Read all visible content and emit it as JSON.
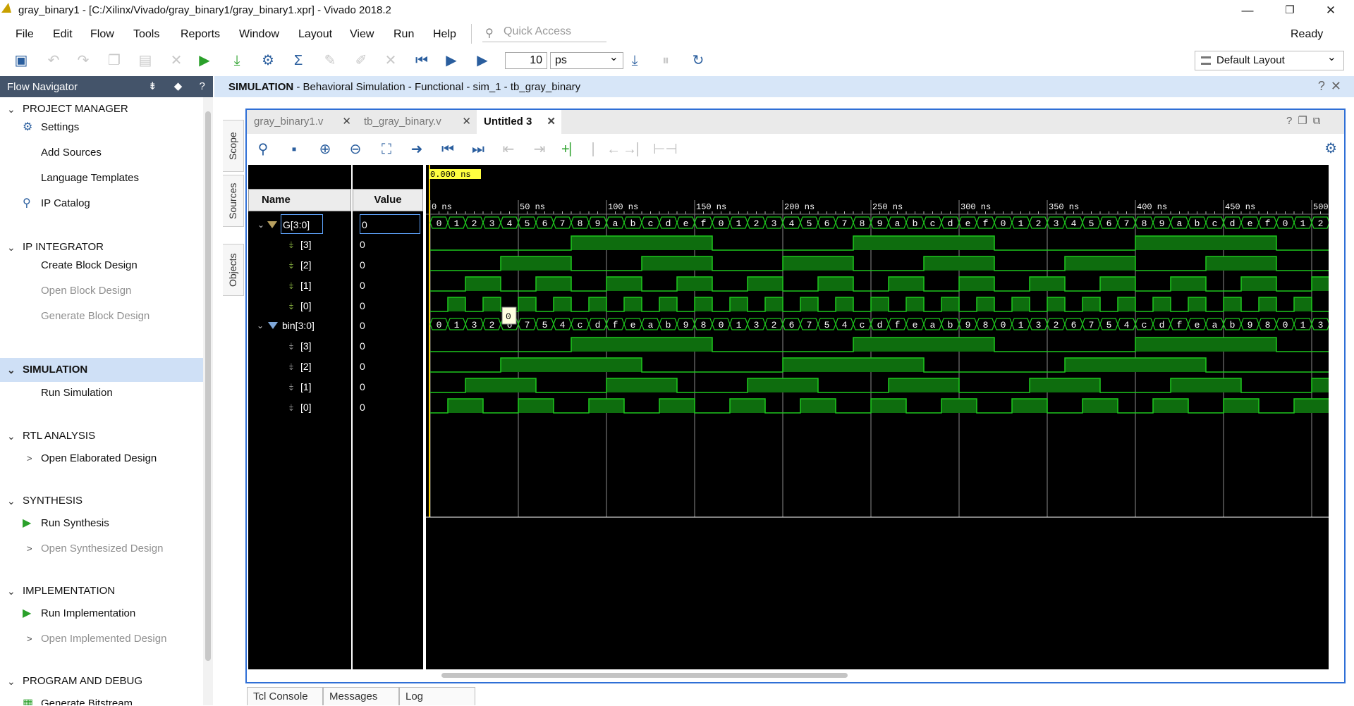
{
  "window": {
    "title": "gray_binary1 - [C:/Xilinx/Vivado/gray_binary1/gray_binary1.xpr] - Vivado 2018.2",
    "minimize": "—",
    "restore": "❐",
    "close": "✕"
  },
  "menu": {
    "items": [
      "File",
      "Edit",
      "Flow",
      "Tools",
      "Reports",
      "Window",
      "Layout",
      "View",
      "Run",
      "Help"
    ]
  },
  "quick_access": {
    "placeholder": "Quick Access"
  },
  "status": "Ready",
  "toolbar": {
    "zoom_value": "10",
    "unit": "ps",
    "layout": "Default Layout"
  },
  "flow_navigator": {
    "title": "Flow Navigator",
    "controls": "⇟ ◆ ? —",
    "sections": [
      {
        "label": "PROJECT MANAGER",
        "items": [
          "Settings",
          "Add Sources",
          "Language Templates",
          "IP Catalog"
        ]
      },
      {
        "label": "IP INTEGRATOR",
        "items": [
          "Create Block Design",
          "Open Block Design",
          "Generate Block Design"
        ]
      },
      {
        "label": "SIMULATION",
        "items": [
          "Run Simulation"
        ]
      },
      {
        "label": "RTL ANALYSIS",
        "items": [
          "Open Elaborated Design"
        ]
      },
      {
        "label": "SYNTHESIS",
        "items": [
          "Run Synthesis",
          "Open Synthesized Design"
        ]
      },
      {
        "label": "IMPLEMENTATION",
        "items": [
          "Run Implementation",
          "Open Implemented Design"
        ]
      },
      {
        "label": "PROGRAM AND DEBUG",
        "items": [
          "Generate Bitstream"
        ]
      }
    ]
  },
  "sim_header": {
    "bold": "SIMULATION",
    "rest": " - Behavioral Simulation - Functional - sim_1 - tb_gray_binary"
  },
  "side_tabs": [
    "Scope",
    "Sources",
    "Objects"
  ],
  "doc_tabs": [
    "gray_binary1.v",
    "tb_gray_binary.v",
    "Untitled 3"
  ],
  "wave": {
    "name_header": "Name",
    "value_header": "Value",
    "cursor_time": "0.000 ns",
    "tooltip": "0",
    "time_labels": [
      "0 ns",
      "50 ns",
      "100 ns",
      "150 ns",
      "200 ns",
      "250 ns",
      "300 ns",
      "350 ns",
      "400 ns",
      "450 ns",
      "500"
    ],
    "signals": [
      {
        "name": "G[3:0]",
        "value": "0",
        "bus": true
      },
      {
        "name": "[3]",
        "value": "0"
      },
      {
        "name": "[2]",
        "value": "0"
      },
      {
        "name": "[1]",
        "value": "0"
      },
      {
        "name": "[0]",
        "value": "0"
      },
      {
        "name": "bin[3:0]",
        "value": "0",
        "bus": true
      },
      {
        "name": "[3]",
        "value": "0"
      },
      {
        "name": "[2]",
        "value": "0"
      },
      {
        "name": "[1]",
        "value": "0"
      },
      {
        "name": "[0]",
        "value": "0"
      }
    ],
    "g_values": [
      "0",
      "1",
      "2",
      "3",
      "4",
      "5",
      "6",
      "7",
      "8",
      "9",
      "a",
      "b",
      "c",
      "d",
      "e",
      "f",
      "0",
      "1",
      "2",
      "3",
      "4",
      "5",
      "6",
      "7",
      "8",
      "9",
      "a",
      "b",
      "c",
      "d",
      "e",
      "f",
      "0",
      "1",
      "2",
      "3",
      "4",
      "5",
      "6",
      "7",
      "8",
      "9",
      "a",
      "b",
      "c",
      "d",
      "e",
      "f",
      "0",
      "1",
      "2"
    ],
    "bin_values": [
      "0",
      "1",
      "3",
      "2",
      "6",
      "7",
      "5",
      "4",
      "c",
      "d",
      "f",
      "e",
      "a",
      "b",
      "9",
      "8",
      "0",
      "1",
      "3",
      "2",
      "6",
      "7",
      "5",
      "4",
      "c",
      "d",
      "f",
      "e",
      "a",
      "b",
      "9",
      "8",
      "0",
      "1",
      "3",
      "2",
      "6",
      "7",
      "5",
      "4",
      "c",
      "d",
      "f",
      "e",
      "a",
      "b",
      "9",
      "8",
      "0",
      "1",
      "3"
    ]
  },
  "bottom_tabs": [
    "Tcl Console",
    "Messages",
    "Log"
  ]
}
